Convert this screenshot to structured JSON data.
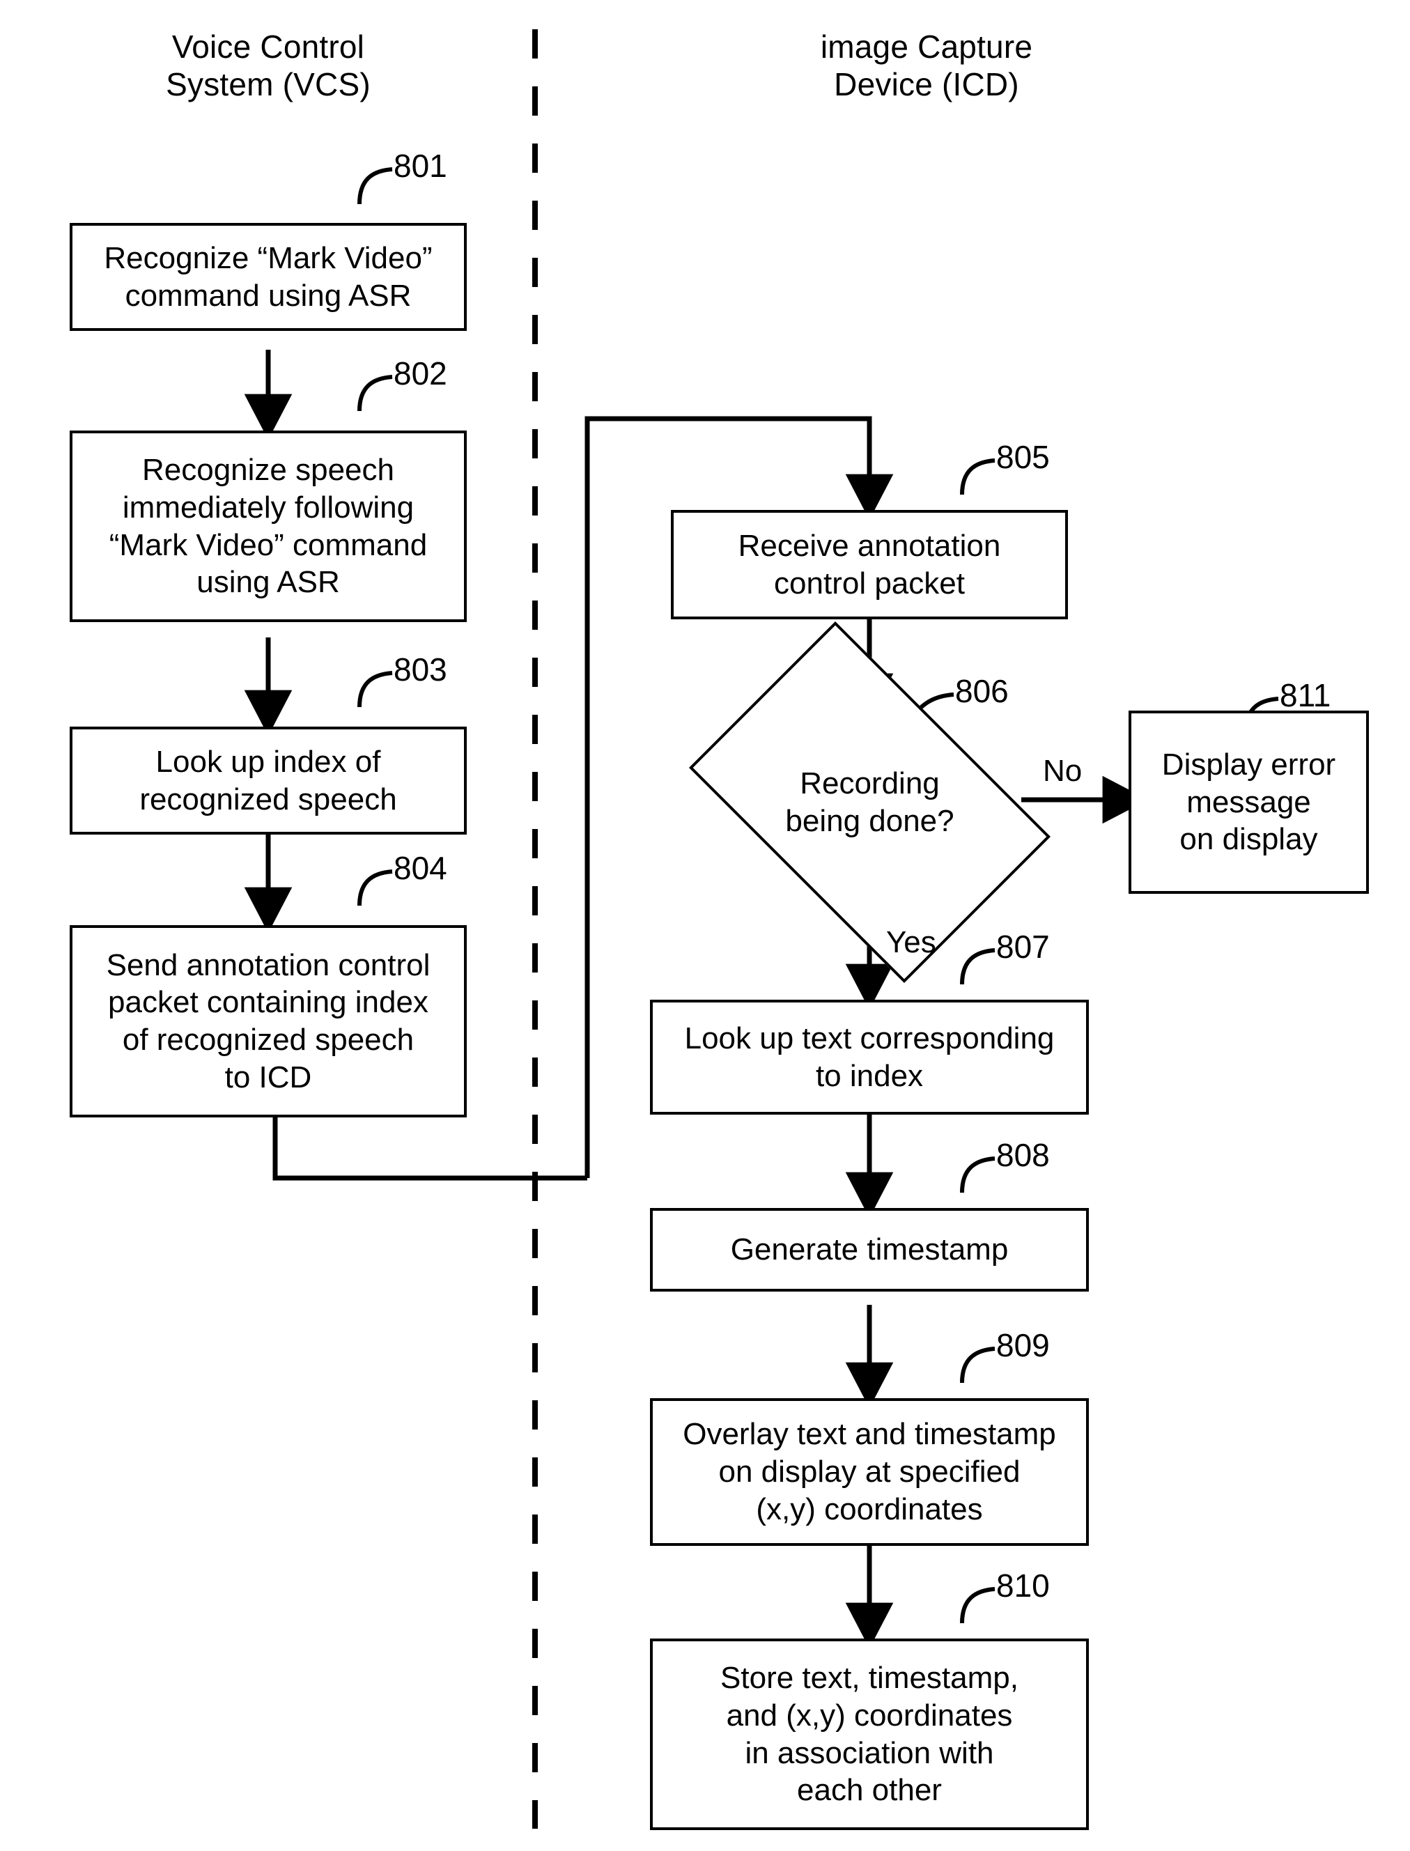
{
  "figure": {
    "columns": [
      {
        "id": "vcs",
        "title": "Voice Control\nSystem (VCS)"
      },
      {
        "id": "icd",
        "title": "image Capture\nDevice (ICD)"
      }
    ],
    "divider": {
      "style": "dashed-vertical"
    },
    "nodes": [
      {
        "id": "n801",
        "ref": "801",
        "shape": "process",
        "column": "vcs",
        "text": "Recognize “Mark Video”\ncommand using ASR"
      },
      {
        "id": "n802",
        "ref": "802",
        "shape": "process",
        "column": "vcs",
        "text": "Recognize speech\nimmediately following\n“Mark Video” command\nusing ASR"
      },
      {
        "id": "n803",
        "ref": "803",
        "shape": "process",
        "column": "vcs",
        "text": "Look up index of\nrecognized speech"
      },
      {
        "id": "n804",
        "ref": "804",
        "shape": "process",
        "column": "vcs",
        "text": "Send annotation control\npacket containing index\nof recognized speech\nto ICD"
      },
      {
        "id": "n805",
        "ref": "805",
        "shape": "process",
        "column": "icd",
        "text": "Receive annotation\ncontrol packet"
      },
      {
        "id": "n806",
        "ref": "806",
        "shape": "decision",
        "column": "icd",
        "text": "Recording\nbeing done?"
      },
      {
        "id": "n811",
        "ref": "811",
        "shape": "process",
        "column": "icd",
        "text": "Display error\nmessage\non display"
      },
      {
        "id": "n807",
        "ref": "807",
        "shape": "process",
        "column": "icd",
        "text": "Look up text corresponding\nto index"
      },
      {
        "id": "n808",
        "ref": "808",
        "shape": "process",
        "column": "icd",
        "text": "Generate timestamp"
      },
      {
        "id": "n809",
        "ref": "809",
        "shape": "process",
        "column": "icd",
        "text": "Overlay text and timestamp\non display at specified\n(x,y) coordinates"
      },
      {
        "id": "n810",
        "ref": "810",
        "shape": "process",
        "column": "icd",
        "text": "Store text, timestamp,\nand (x,y) coordinates\nin association with\neach other"
      }
    ],
    "branch_labels": {
      "no": "No",
      "yes": "Yes"
    },
    "colors": {
      "ink": "#000000",
      "paper": "#ffffff"
    }
  }
}
